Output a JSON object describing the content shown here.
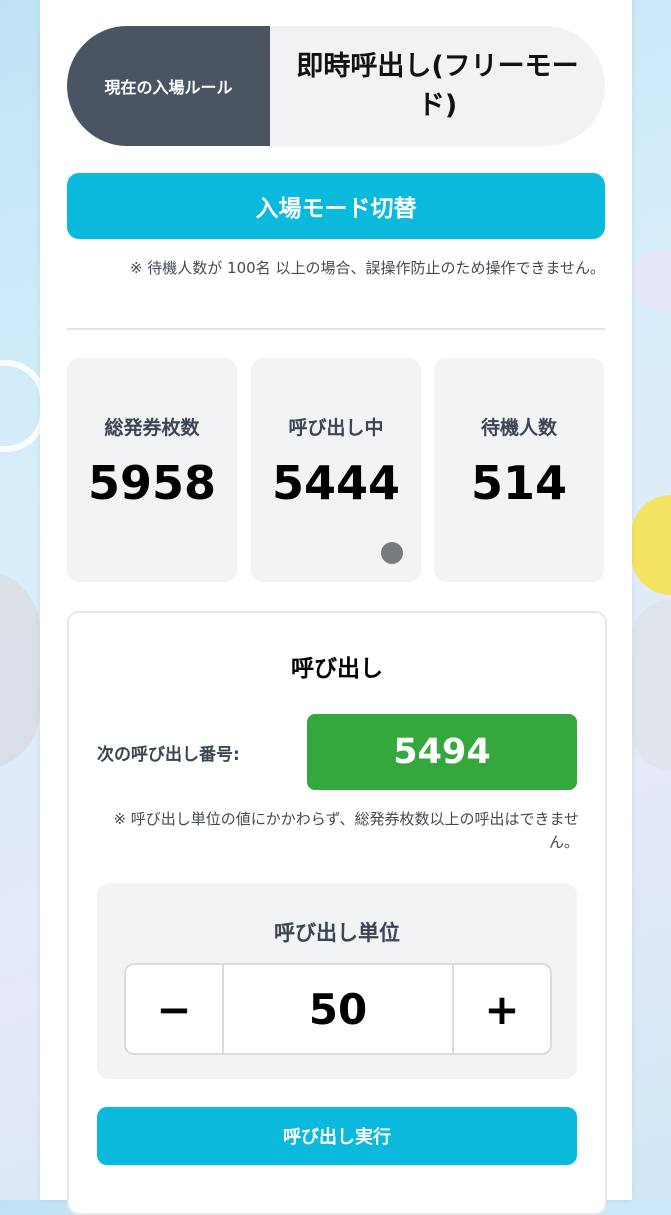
{
  "entry_rule": {
    "label": "現在の入場ルール",
    "value": "即時呼出し(フリーモード)"
  },
  "switch_button": {
    "label": "入場モード切替",
    "note": "※ 待機人数が 100名 以上の場合、誤操作防止のため操作できません。"
  },
  "stats": [
    {
      "label": "総発券枚数",
      "value": "5958"
    },
    {
      "label": "呼び出し中",
      "value": "5444"
    },
    {
      "label": "待機人数",
      "value": "514"
    }
  ],
  "call": {
    "title": "呼び出し",
    "next_label": "次の呼び出し番号:",
    "next_number": "5494",
    "note": "※ 呼び出し単位の値にかかわらず、総発券枚数以上の呼出はできません。",
    "unit_title": "呼び出し単位",
    "unit_value": "50",
    "minus_symbol": "−",
    "plus_symbol": "+",
    "execute_label": "呼び出し実行"
  },
  "colors": {
    "accent": "#0ab9dc",
    "next_number_bg": "#34a83d",
    "rule_label_bg": "#4a5463"
  }
}
